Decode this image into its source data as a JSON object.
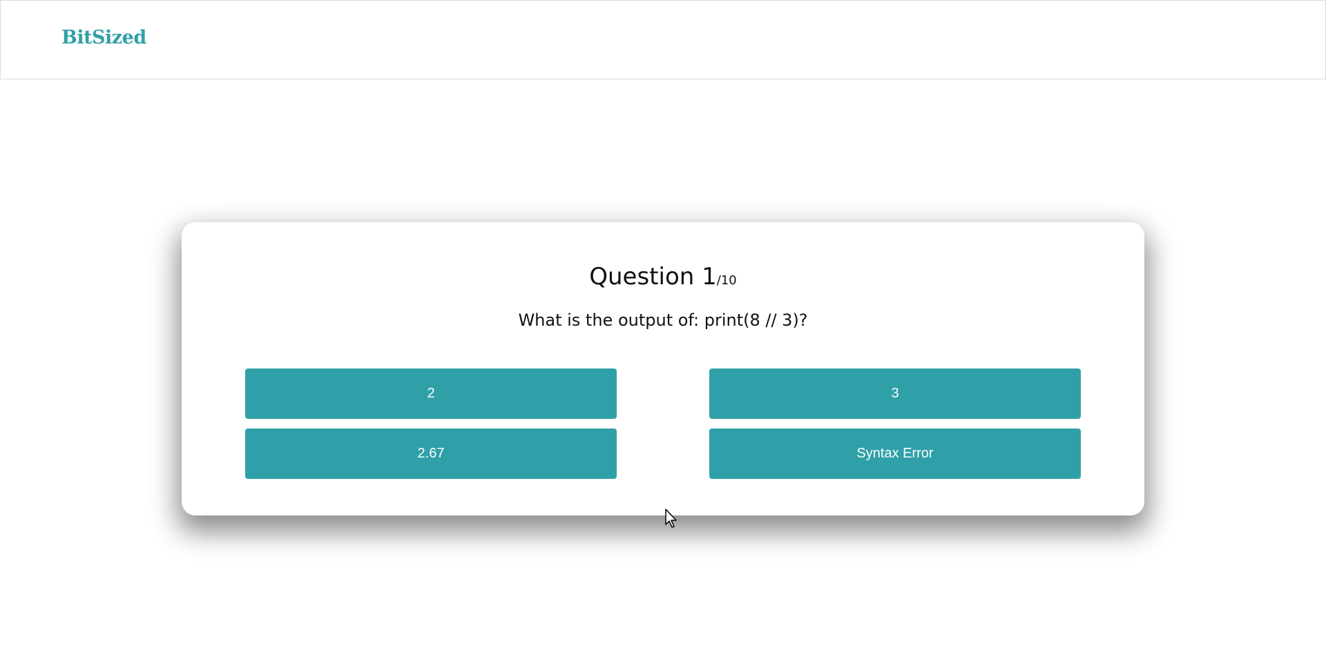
{
  "header": {
    "brand": "BitSized"
  },
  "quiz": {
    "question_label": "Question 1",
    "question_total": "/10",
    "question_text": "What is the output of: print(8 // 3)?",
    "answers": [
      "2",
      "3",
      "2.67",
      "Syntax Error"
    ]
  },
  "colors": {
    "accent": "#30a0a8",
    "text": "#111111",
    "background": "#ffffff"
  },
  "icons": {
    "cursor": "mouse-pointer-icon"
  }
}
